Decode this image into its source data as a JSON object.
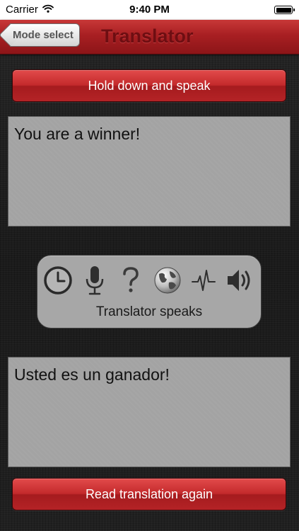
{
  "status_bar": {
    "carrier": "Carrier",
    "time": "9:40 PM",
    "icons": [
      "wifi-icon",
      "battery-icon"
    ]
  },
  "nav": {
    "back_label": "Mode select",
    "title": "Translator"
  },
  "speak_button_label": "Hold down and speak",
  "source_text": "You are a winner!",
  "mode_panel": {
    "icons": [
      "clock-icon",
      "microphone-icon",
      "question-icon",
      "globe-icon",
      "waveform-icon",
      "speaker-icon"
    ],
    "label": "Translator speaks"
  },
  "translated_text": "Usted es un ganador!",
  "read_again_label": "Read translation again",
  "colors": {
    "accent_red": "#c42a2c",
    "nav_title": "#6e0e12",
    "panel_gray": "#a3a3a3"
  }
}
